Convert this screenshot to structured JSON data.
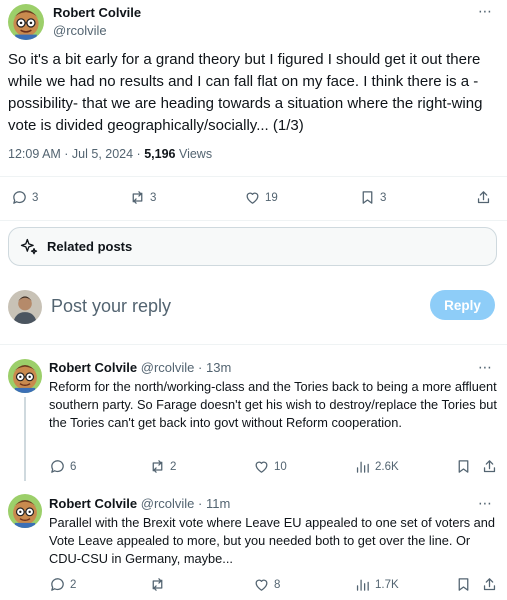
{
  "main_tweet": {
    "author_name": "Robert Colvile",
    "author_handle": "@rcolvile",
    "text": "So it's a bit early for a grand theory but I figured I should get it out there while we had no results and I can fall flat on my face. I think there is a -possibility- that we are heading towards a situation where the right-wing vote is divided geographically/socially... (1/3)",
    "timestamp": "12:09 AM · Jul 5, 2024 · ",
    "views_count": "5,196",
    "views_label": " Views",
    "more_icon": "⋯",
    "actions": {
      "replies": "3",
      "reposts": "3",
      "likes": "19",
      "bookmarks": "3"
    }
  },
  "related_posts": {
    "label": "Related posts",
    "icon": "sparkle-icon"
  },
  "reply_composer": {
    "placeholder": "Post your reply",
    "button_label": "Reply"
  },
  "replies": [
    {
      "author_name": "Robert Colvile",
      "author_handle": "@rcolvile",
      "separator": "·",
      "time": "13m",
      "text": "Reform for the north/working-class and the Tories back to being a more affluent southern party. So Farage doesn't get his wish to destroy/replace the Tories but the Tories can't get back into govt without Reform cooperation.",
      "more_icon": "⋯",
      "actions": {
        "replies": "6",
        "reposts": "2",
        "likes": "10",
        "views": "2.6K"
      }
    },
    {
      "author_name": "Robert Colvile",
      "author_handle": "@rcolvile",
      "separator": "·",
      "time": "11m",
      "text": "Parallel with the Brexit vote where Leave EU appealed to one set of voters and Vote Leave appealed to more, but you needed both to get over the line. Or CDU-CSU in Germany, maybe...",
      "more_icon": "⋯",
      "actions": {
        "replies": "2",
        "reposts": "",
        "likes": "8",
        "views": "1.7K"
      }
    }
  ],
  "colors": {
    "accent_disabled": "#8ecdf8",
    "text_primary": "#0f1419",
    "text_secondary": "#536471",
    "border": "#cfd9de"
  }
}
